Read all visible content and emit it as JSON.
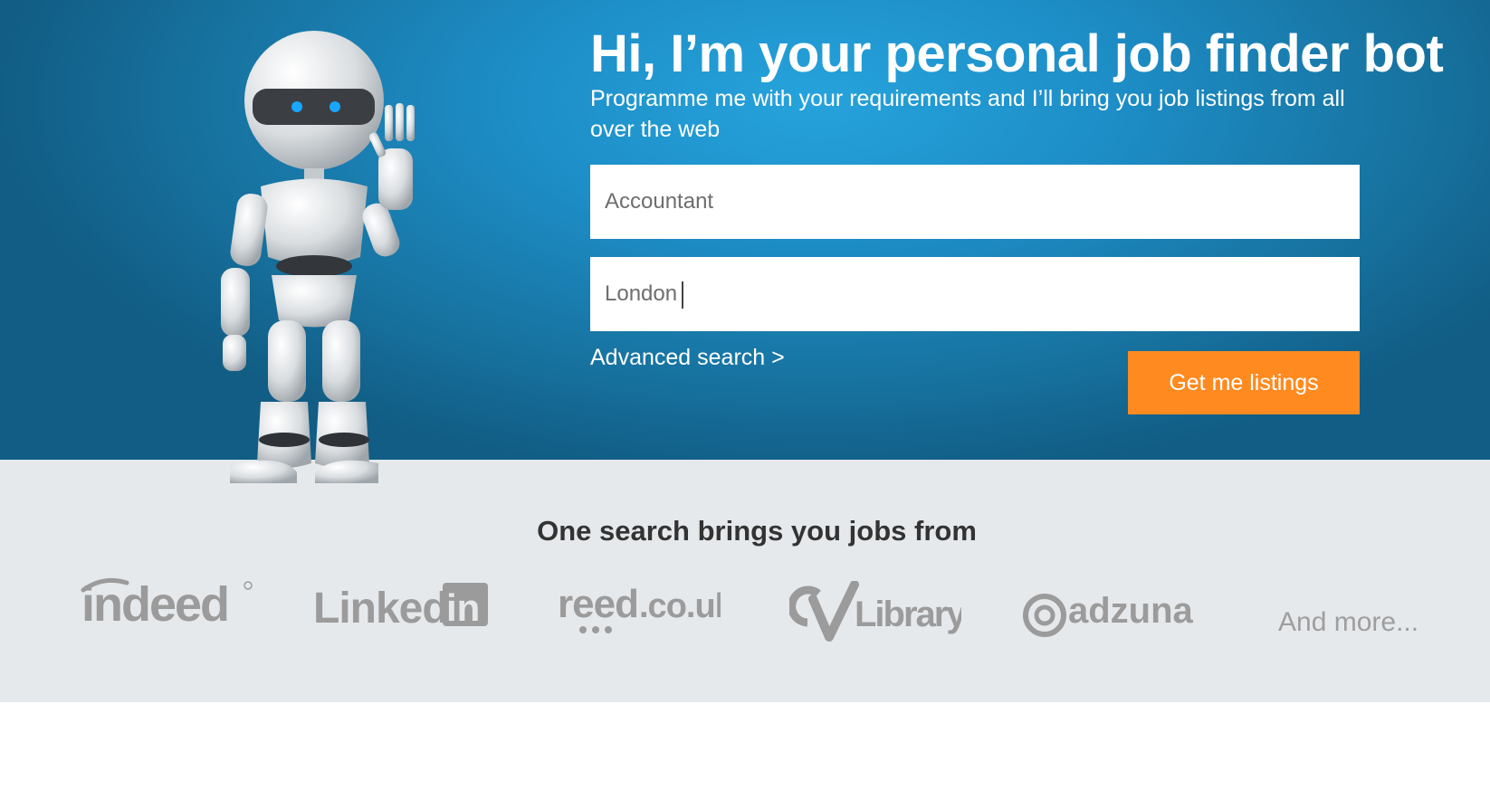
{
  "hero": {
    "title": "Hi, I’m your personal job finder bot",
    "subtitle": "Programme me with your requirements and I’ll bring you job listings from all over the web",
    "job_field": {
      "value": "Accountant"
    },
    "location_field": {
      "value": "London"
    },
    "advanced_link": "Advanced search >",
    "cta_label": "Get me listings"
  },
  "partners": {
    "heading": "One search brings you jobs from",
    "logos": {
      "indeed": "indeed",
      "linkedin_word": "Linked",
      "linkedin_box": "in",
      "reed_main": "reed",
      "reed_domain": ".co.uk",
      "cvlibrary_word": "Library",
      "adzuna": "adzuna"
    },
    "more_label": "And more..."
  },
  "colors": {
    "hero_blue": "#1d8dc6",
    "cta_orange": "#ff8a1f",
    "partners_bg": "#e6e9ec",
    "logo_grey": "#9b9b9b"
  }
}
